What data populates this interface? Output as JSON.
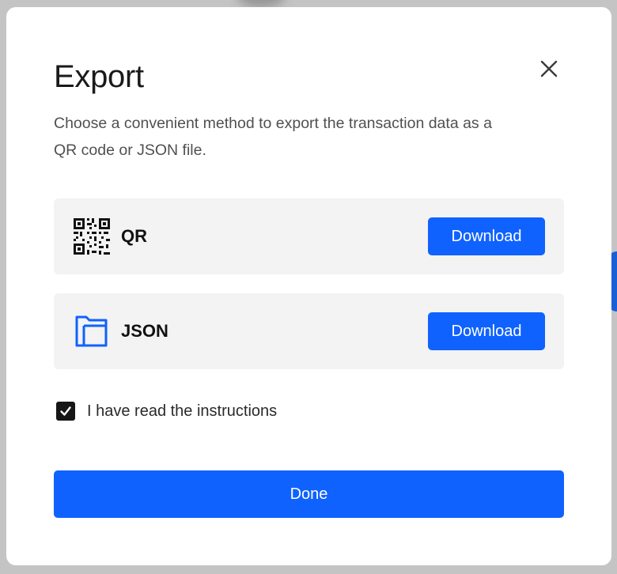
{
  "dialog": {
    "title": "Export",
    "description": "Choose a convenient method to export the transaction data as a QR code or JSON file.",
    "close_icon": "close-icon"
  },
  "options": [
    {
      "label": "QR",
      "icon": "qr-code-icon",
      "button_label": "Download"
    },
    {
      "label": "JSON",
      "icon": "folder-icon",
      "button_label": "Download"
    }
  ],
  "confirmation": {
    "label": "I have read the instructions",
    "checked": true
  },
  "footer": {
    "done_label": "Done"
  },
  "colors": {
    "primary": "#0f62fe",
    "card_background": "#f3f3f3",
    "checkbox": "#161616"
  }
}
